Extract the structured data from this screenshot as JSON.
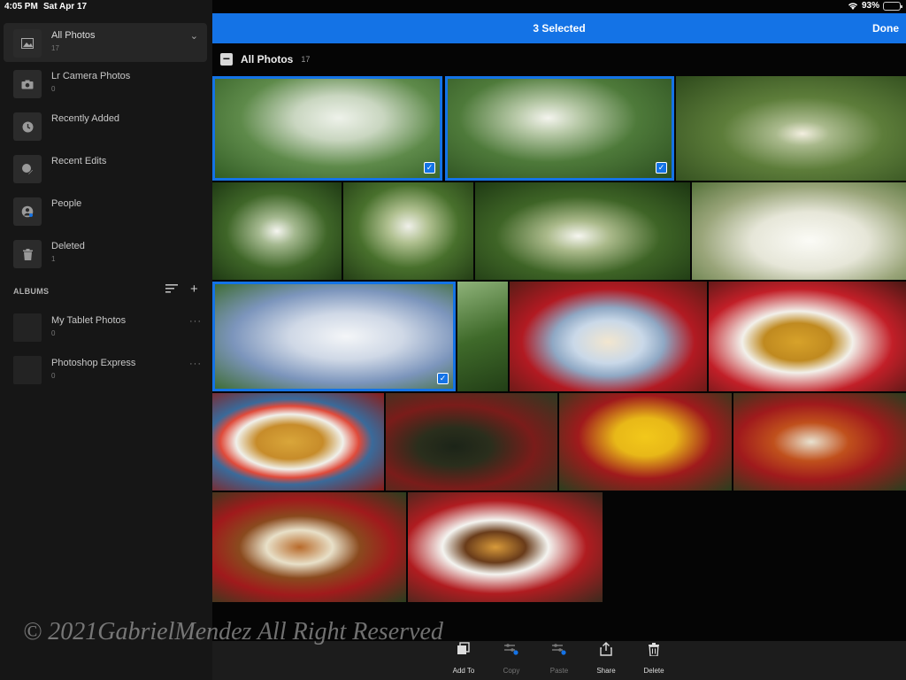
{
  "status": {
    "time": "4:05 PM",
    "date": "Sat Apr 17",
    "battery": "93%",
    "battery_level": 0.93
  },
  "sidebar": {
    "items": [
      {
        "label": "All Photos",
        "count": "17",
        "icon": "photos-icon"
      },
      {
        "label": "Lr Camera Photos",
        "count": "0",
        "icon": "camera-icon"
      },
      {
        "label": "Recently Added",
        "count": "",
        "icon": "clock-icon"
      },
      {
        "label": "Recent Edits",
        "count": "",
        "icon": "edit-icon"
      },
      {
        "label": "People",
        "count": "",
        "icon": "person-icon"
      },
      {
        "label": "Deleted",
        "count": "1",
        "icon": "trash-icon"
      }
    ],
    "albums_header": "ALBUMS",
    "albums": [
      {
        "label": "My Tablet Photos",
        "count": "0"
      },
      {
        "label": "Photoshop Express",
        "count": "0"
      }
    ]
  },
  "topbar": {
    "selected_text": "3 Selected",
    "done_label": "Done"
  },
  "grid": {
    "title": "All Photos",
    "count": "17"
  },
  "watermark": "© 2021GabrielMendez All Right Reserved",
  "toolbar": {
    "add_to": "Add To",
    "copy": "Copy",
    "paste": "Paste",
    "share": "Share",
    "delete": "Delete"
  },
  "colors": {
    "accent": "#1473e6",
    "sidebar_bg": "#161616",
    "toolbar_bg": "#1c1c1c"
  }
}
